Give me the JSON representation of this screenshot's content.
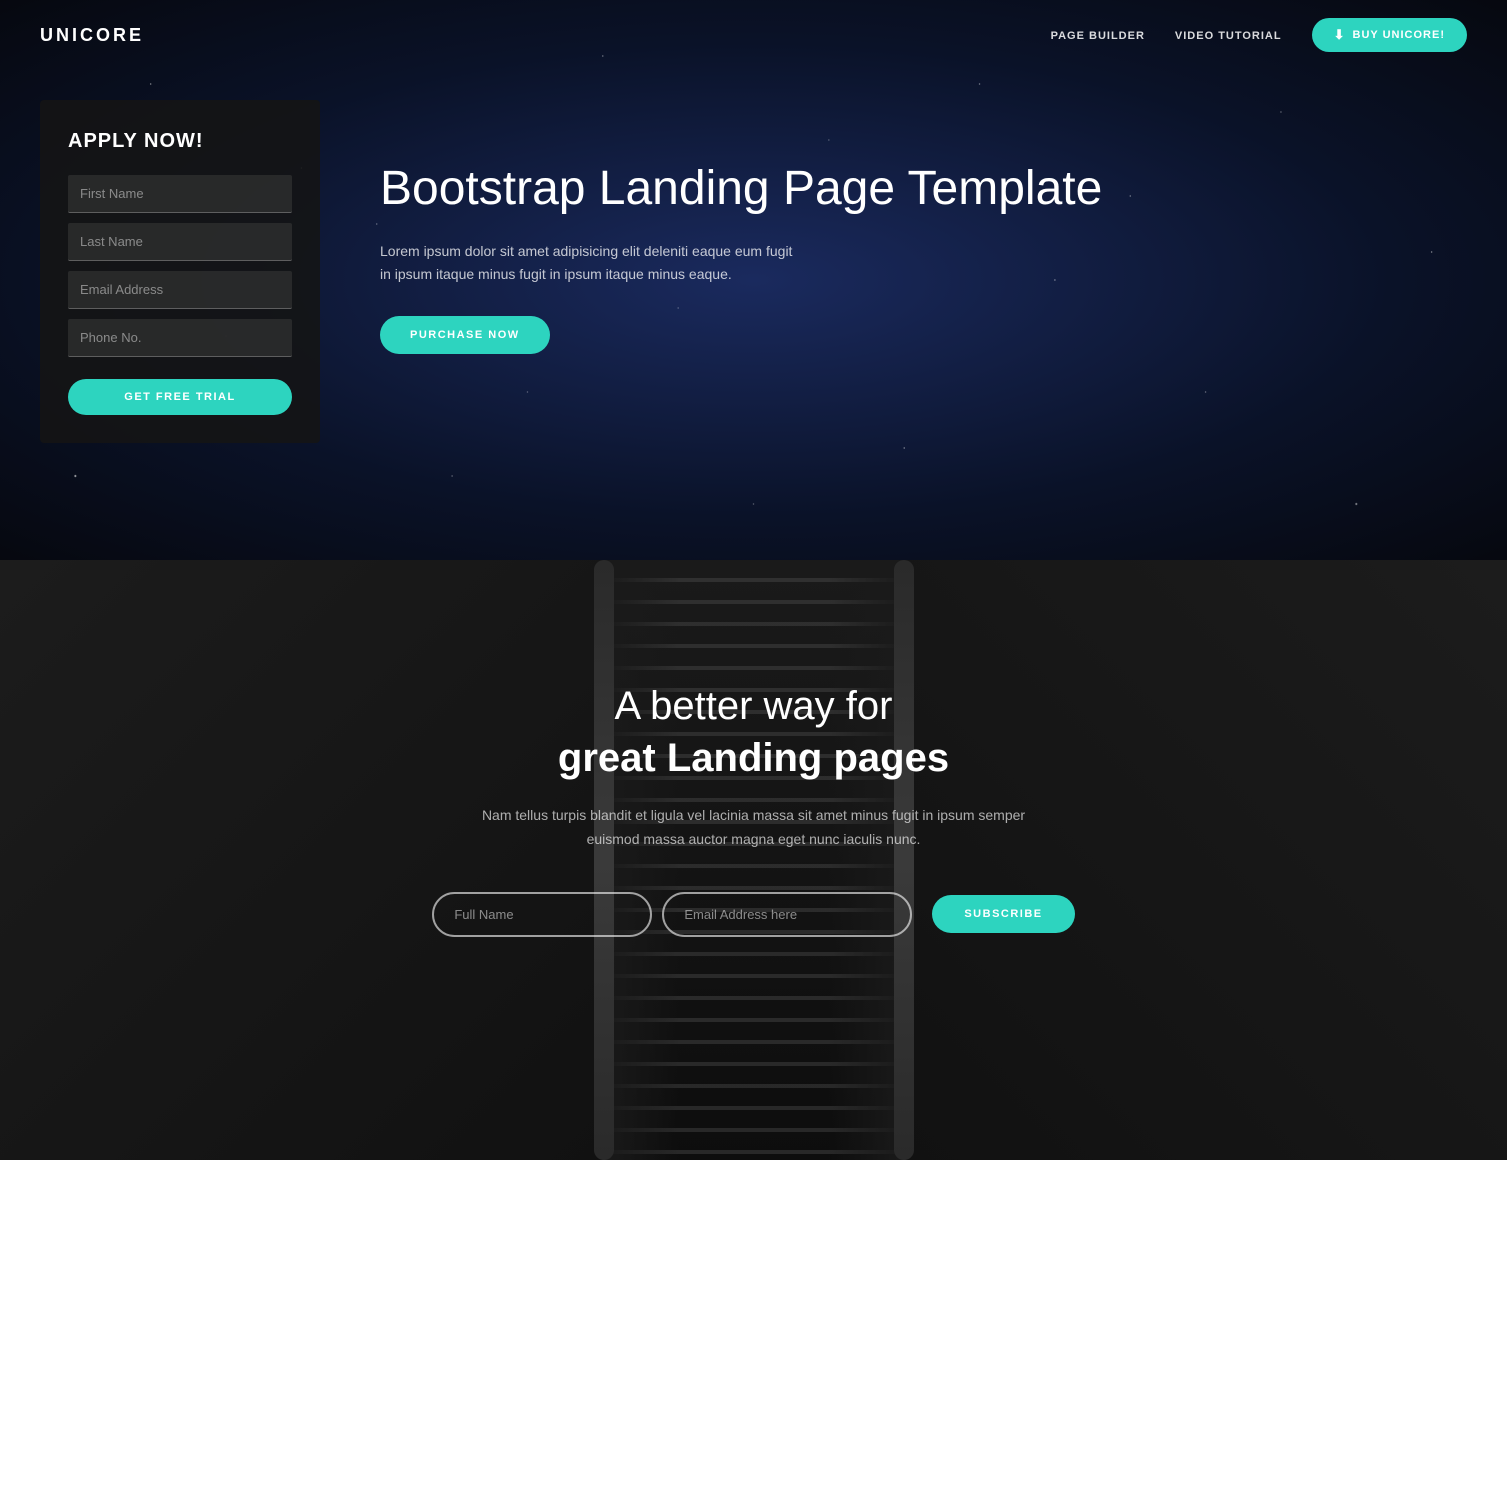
{
  "brand": {
    "name": "UNICORE"
  },
  "navbar": {
    "links": [
      {
        "id": "page-builder",
        "label": "PAGE BUILDER"
      },
      {
        "id": "video-tutorial",
        "label": "VIDEO TUTORIAL"
      }
    ],
    "cta": {
      "label": "BUY UNICORE!",
      "icon": "⬇"
    }
  },
  "hero": {
    "apply_form": {
      "title": "APPLY NOW!",
      "fields": [
        {
          "id": "first-name",
          "placeholder": "First Name"
        },
        {
          "id": "last-name",
          "placeholder": "Last Name"
        },
        {
          "id": "email",
          "placeholder": "Email Address"
        },
        {
          "id": "phone",
          "placeholder": "Phone No."
        }
      ],
      "submit_label": "GET FREE TRIAL"
    },
    "heading": "Bootstrap Landing Page Template",
    "description": "Lorem ipsum dolor sit amet adipisicing elit deleniti eaque eum fugit in ipsum itaque minus fugit in ipsum itaque minus eaque.",
    "cta_label": "PURCHASE NOW"
  },
  "section2": {
    "title_line1": "A better way for",
    "title_line2": "great Landing pages",
    "description": "Nam tellus turpis blandit et ligula vel lacinia massa sit amet minus fugit in ipsum semper euismod massa auctor magna eget nunc iaculis nunc.",
    "subscribe_form": {
      "full_name_placeholder": "Full Name",
      "email_placeholder": "Email Address here",
      "submit_label": "SUBSCRIBE"
    }
  },
  "colors": {
    "accent": "#2dd4bf",
    "hero_bg_dark": "#0a1228",
    "card_bg": "rgba(20,20,20,0.88)",
    "escalator_bg": "#111"
  }
}
